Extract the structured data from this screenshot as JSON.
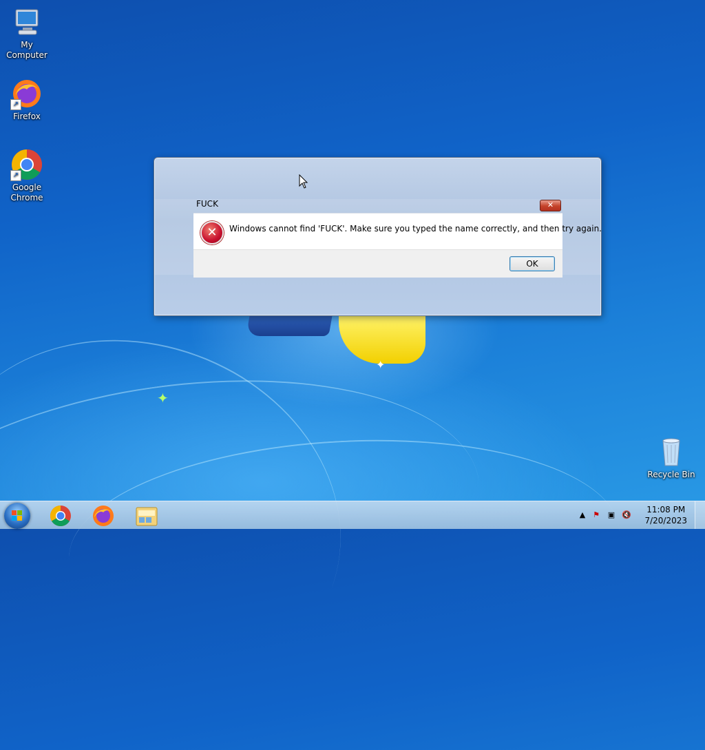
{
  "desktop": {
    "icons": [
      {
        "label": "My Computer",
        "icon": "computer-icon"
      },
      {
        "label": "Firefox",
        "icon": "firefox-icon"
      },
      {
        "label": "Google Chrome",
        "icon": "chrome-icon"
      },
      {
        "label": "Recycle Bin",
        "icon": "recycle-bin-icon"
      }
    ]
  },
  "dialog": {
    "title": "FUCK",
    "message": "Windows cannot find 'FUCK'. Make sure you typed the name correctly, and then try again.",
    "ok_label": "OK",
    "close_glyph": "✕",
    "icon": "error-icon"
  },
  "taskbar": {
    "apps": [
      "chrome-icon",
      "firefox-icon",
      "file-explorer-icon"
    ],
    "tray": {
      "time": "11:08 PM",
      "date": "7/20/2023",
      "icons": [
        "show-hidden-icons-arrow",
        "action-center-flag-icon",
        "network-icon",
        "volume-muted-icon"
      ]
    }
  },
  "colors": {
    "desktop_blue": "#1063c8",
    "close_red": "#c4422a",
    "error_red": "#c8102e"
  }
}
